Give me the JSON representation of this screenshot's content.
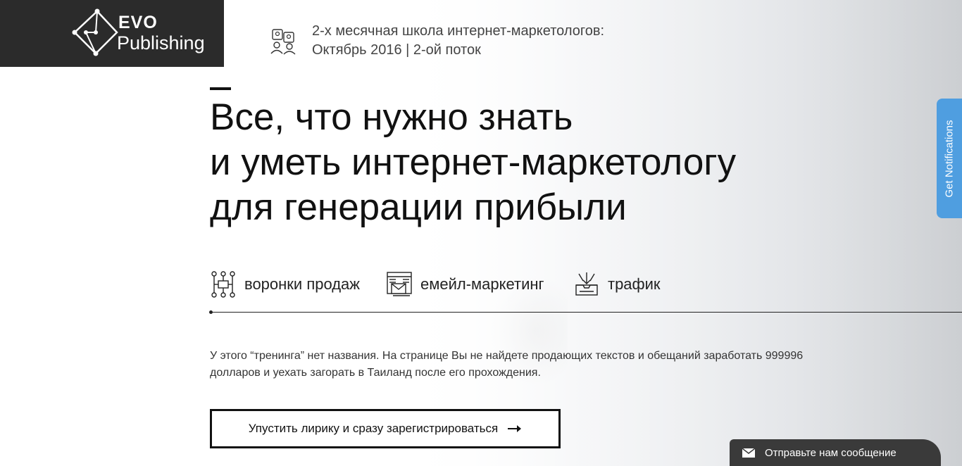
{
  "logo": {
    "word1": "EVO",
    "word2": "Publishing"
  },
  "header_info": {
    "icon": "people-chat-icon",
    "line1": "2-х месячная школа интернет-маркетологов:",
    "line2": "Октябрь 2016 | 2-ой поток"
  },
  "hero": {
    "title_lines": [
      "Все, что нужно знать",
      "и уметь интернет-маркетологу",
      "для генерации прибыли"
    ]
  },
  "features": [
    {
      "icon": "sales-funnel-icon",
      "label": "воронки продаж"
    },
    {
      "icon": "email-marketing-icon",
      "label": "емейл-маркетинг"
    },
    {
      "icon": "traffic-inbox-icon",
      "label": "трафик"
    }
  ],
  "description": "У этого “тренинга” нет названия. На странице Вы не найдете продающих текстов и обещаний заработать 999996 долларов и уехать загорать в Таиланд после его прохождения.",
  "cta": {
    "label": "Упустить лирику и сразу зарегистрироваться",
    "icon": "arrow-right-icon"
  },
  "notifications_tab": {
    "label": "Get Notifications"
  },
  "chat": {
    "icon": "envelope-icon",
    "label": "Отправьте нам сообщение"
  },
  "colors": {
    "logo_bg": "#2b2b2b",
    "notif_blue": "#4f9ee0",
    "chat_bg": "#3a3a3a"
  }
}
